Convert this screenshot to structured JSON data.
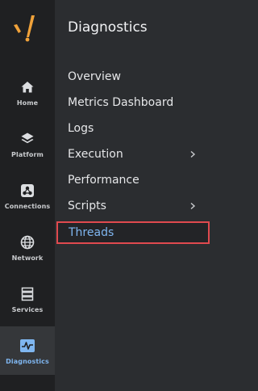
{
  "rail": {
    "items": [
      {
        "label": "Home",
        "icon": "home-icon"
      },
      {
        "label": "Platform",
        "icon": "layers-icon"
      },
      {
        "label": "Connections",
        "icon": "connections-icon"
      },
      {
        "label": "Network",
        "icon": "globe-icon"
      },
      {
        "label": "Services",
        "icon": "services-icon"
      },
      {
        "label": "Diagnostics",
        "icon": "pulse-icon"
      }
    ],
    "active": "Diagnostics"
  },
  "panel": {
    "title": "Diagnostics",
    "items": [
      {
        "label": "Overview",
        "has_submenu": false
      },
      {
        "label": "Metrics Dashboard",
        "has_submenu": false
      },
      {
        "label": "Logs",
        "has_submenu": false
      },
      {
        "label": "Execution",
        "has_submenu": true
      },
      {
        "label": "Performance",
        "has_submenu": false
      },
      {
        "label": "Scripts",
        "has_submenu": true
      },
      {
        "label": "Threads",
        "has_submenu": false
      }
    ],
    "selected": "Threads"
  },
  "colors": {
    "accent": "#7fb6f0",
    "logo": "#f0a23a",
    "highlight_border": "#e04a4f"
  }
}
